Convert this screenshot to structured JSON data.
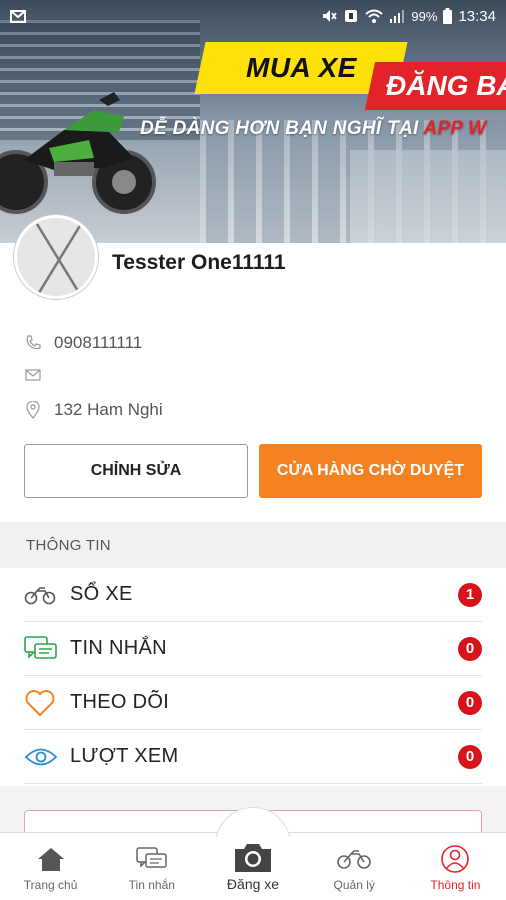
{
  "status_bar": {
    "battery": "99%",
    "time": "13:34"
  },
  "banner": {
    "headline_1": "MUA XE",
    "headline_2": "ĐĂNG BÁ",
    "tagline_main": "DỄ DÀNG HƠN BẠN NGHĨ TẠI",
    "tagline_accent": "APP W",
    "colors": {
      "yellow": "#ffe10a",
      "red": "#e2232a"
    }
  },
  "profile": {
    "name": "Tesster One11111",
    "phone": "0908111111",
    "email": "",
    "address": "132 Ham Nghi"
  },
  "actions": {
    "edit_label": "CHỈNH SỬA",
    "store_label": "CỬA HÀNG CHỜ DUYỆT",
    "store_color": "#f58220"
  },
  "section": {
    "title": "THÔNG TIN"
  },
  "menu": [
    {
      "label": "SỔ XE",
      "count": "1",
      "icon": "motorbike-icon"
    },
    {
      "label": "TIN NHẮN",
      "count": "0",
      "icon": "chat-icon"
    },
    {
      "label": "THEO DÕI",
      "count": "0",
      "icon": "heart-icon"
    },
    {
      "label": "LƯỢT XEM",
      "count": "0",
      "icon": "eye-icon"
    }
  ],
  "bottom_nav": [
    {
      "label": "Trang chủ",
      "icon": "home-icon"
    },
    {
      "label": "Tin nhắn",
      "icon": "chat-icon"
    },
    {
      "label": "Đăng xe",
      "icon": "camera-icon"
    },
    {
      "label": "Quản lý",
      "icon": "motorbike-icon"
    },
    {
      "label": "Thông tin",
      "icon": "user-icon",
      "active": true
    }
  ]
}
